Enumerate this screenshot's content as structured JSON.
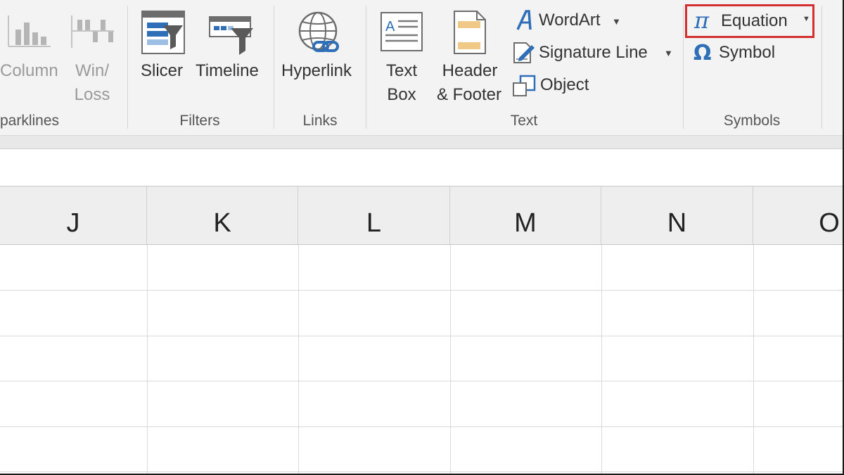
{
  "ribbon": {
    "sparklines": {
      "group_label": "parklines",
      "column_label": "Column",
      "winloss_label_1": "Win/",
      "winloss_label_2": "Loss"
    },
    "filters": {
      "group_label": "Filters",
      "slicer_label": "Slicer",
      "timeline_label": "Timeline"
    },
    "links": {
      "group_label": "Links",
      "hyperlink_label": "Hyperlink"
    },
    "text": {
      "group_label": "Text",
      "textbox_label_1": "Text",
      "textbox_label_2": "Box",
      "header_label_1": "Header",
      "header_label_2": "& Footer",
      "wordart_label": "WordArt",
      "signature_label": "Signature Line",
      "object_label": "Object"
    },
    "symbols": {
      "group_label": "Symbols",
      "equation_label": "Equation",
      "symbol_label": "Symbol",
      "pi_glyph": "π",
      "omega_glyph": "Ω",
      "highlight_color": "#d32f2f"
    }
  },
  "sheet": {
    "columns": [
      "J",
      "K",
      "L",
      "M",
      "N",
      "O"
    ]
  }
}
